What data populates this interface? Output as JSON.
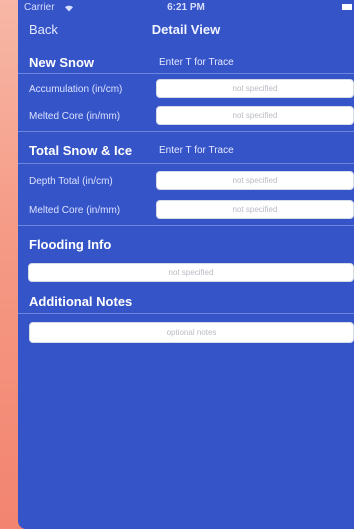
{
  "status_bar": {
    "carrier": "Carrier",
    "time": "6:21 PM"
  },
  "nav": {
    "back_label": "Back",
    "title": "Detail View"
  },
  "new_snow": {
    "header": "New Snow",
    "hint": "Enter T for Trace",
    "accumulation_label": "Accumulation (in/cm)",
    "accumulation_placeholder": "not specified",
    "melted_core_label": "Melted Core (in/mm)",
    "melted_core_placeholder": "not specified"
  },
  "total_snow": {
    "header": "Total Snow & Ice",
    "hint": "Enter T for Trace",
    "depth_label": "Depth Total (in/cm)",
    "depth_placeholder": "not specified",
    "melted_core_label": "Melted Core (in/mm)",
    "melted_core_placeholder": "not specified"
  },
  "flooding": {
    "header": "Flooding Info",
    "placeholder": "not specified"
  },
  "notes": {
    "header": "Additional Notes",
    "placeholder": "optional notes"
  },
  "colors": {
    "background_gradient": "#f59a85",
    "screen_blue": "#3554c8",
    "field_bg": "#ffffff",
    "placeholder_text": "#b9bcc4"
  }
}
